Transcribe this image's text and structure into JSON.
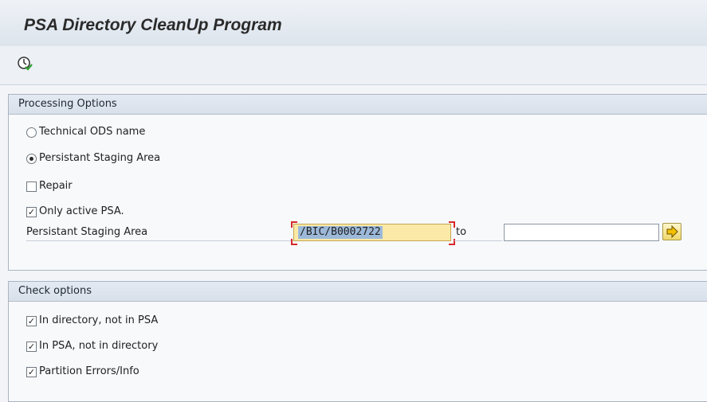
{
  "title": "PSA Directory CleanUp Program",
  "toolbar": {
    "execute_icon": "execute-clock-icon"
  },
  "processing": {
    "header": "Processing Options",
    "opt_technical": "Technical ODS name",
    "opt_psa": "Persistant Staging Area",
    "repair": "Repair",
    "only_active": "Only active PSA.",
    "field_label": "Persistant Staging Area",
    "low_value": "/BIC/B0002722",
    "to_label": "to",
    "high_value": ""
  },
  "check": {
    "header": "Check options",
    "opt1": "In directory, not in PSA",
    "opt2": "In PSA, not in directory",
    "opt3": "Partition Errors/Info"
  }
}
